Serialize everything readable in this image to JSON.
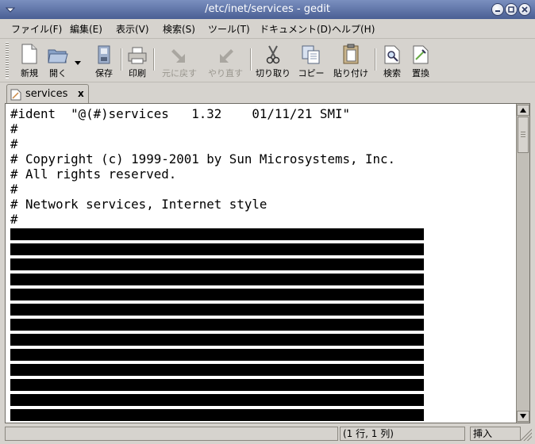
{
  "window": {
    "title": "/etc/inet/services - gedit"
  },
  "menu": [
    "ファイル(F)",
    "編集(E)",
    "表示(V)",
    "検索(S)",
    "ツール(T)",
    "ドキュメント(D)",
    "ヘルプ(H)"
  ],
  "toolbar": {
    "new": "新規",
    "open": "開く",
    "save": "保存",
    "print": "印刷",
    "undo": "元に戻す",
    "redo": "やり直す",
    "cut": "切り取り",
    "copy": "コピー",
    "paste": "貼り付け",
    "find": "検索",
    "replace": "置換"
  },
  "tab": {
    "label": "services",
    "close": "x"
  },
  "editor": {
    "lines": [
      "#ident  \"@(#)services   1.32    01/11/21 SMI\"",
      "#",
      "#",
      "# Copyright (c) 1999-2001 by Sun Microsystems, Inc.",
      "# All rights reserved.",
      "#",
      "# Network services, Internet style",
      "#"
    ],
    "redacted_line_count": 13
  },
  "statusbar": {
    "position": "(1 行, 1 列)",
    "mode": "挿入"
  }
}
